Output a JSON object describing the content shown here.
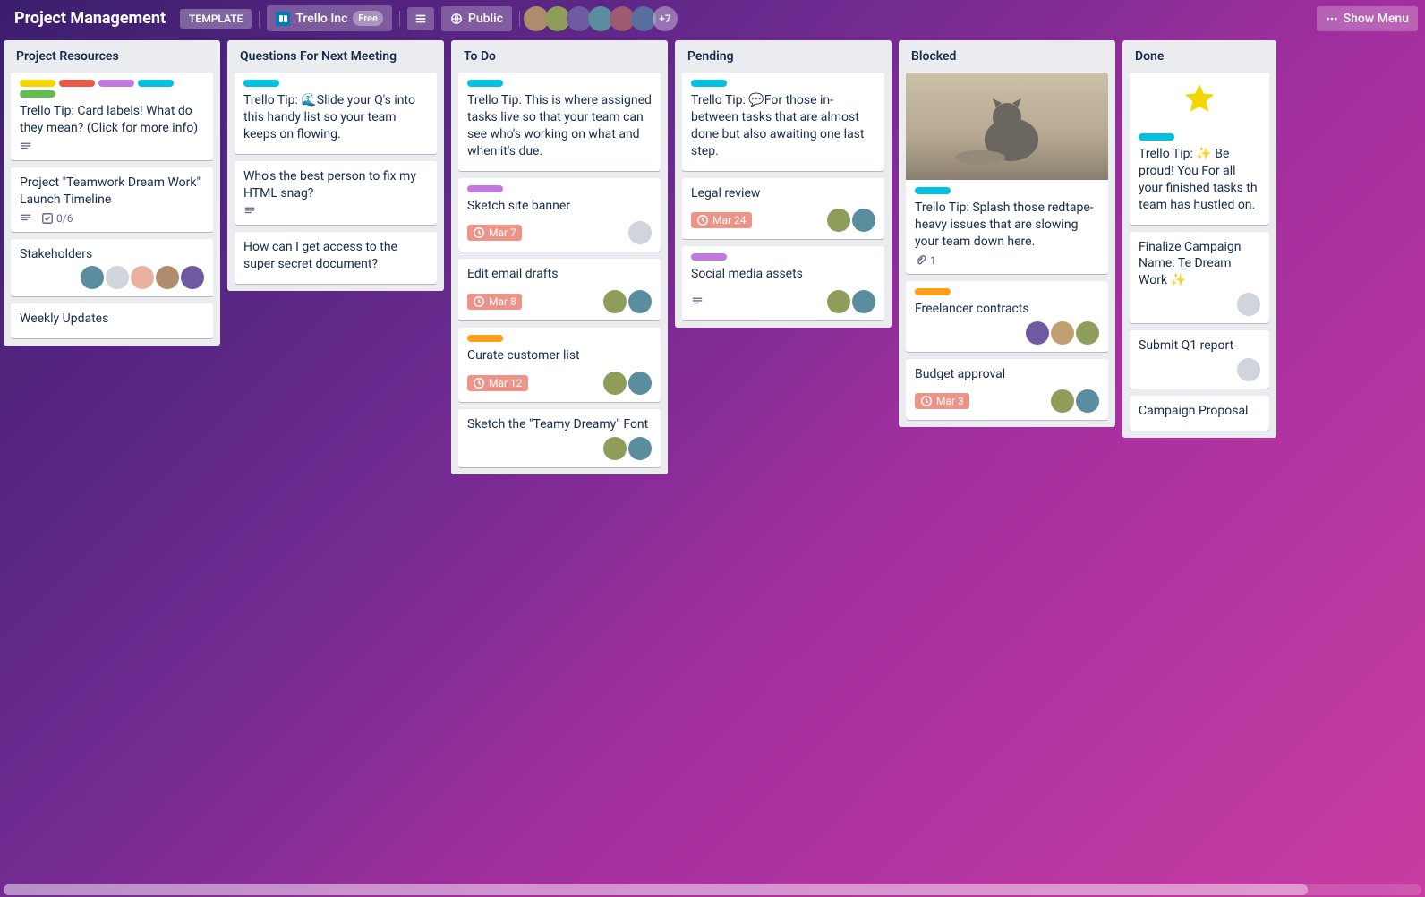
{
  "colors": {
    "yellow": "#f2d600",
    "red": "#eb5a46",
    "purple": "#c377e0",
    "sky": "#00c2e0",
    "green": "#61bd4f",
    "orange": "#ff9f1a"
  },
  "header": {
    "board_name": "Project Management",
    "template_badge": "TEMPLATE",
    "workspace": "Trello Inc",
    "workspace_pill": "Free",
    "visibility": "Public",
    "extra_members": "+7",
    "show_menu": "Show Menu"
  },
  "lists": [
    {
      "title": "Project Resources",
      "cards": [
        {
          "labels": [
            "yellow",
            "red",
            "purple",
            "sky",
            "green"
          ],
          "title": "Trello Tip: Card labels! What do they mean? (Click for more info)",
          "desc": true
        },
        {
          "title": "Project \"Teamwork Dream Work\" Launch Timeline",
          "desc": true,
          "checklist": "0/6"
        },
        {
          "title": "Stakeholders",
          "members": 5
        },
        {
          "title": "Weekly Updates"
        }
      ]
    },
    {
      "title": "Questions For Next Meeting",
      "cards": [
        {
          "labels": [
            "sky"
          ],
          "title": "Trello Tip: 🌊Slide your Q's into this handy list so your team keeps on flowing."
        },
        {
          "title": "Who's the best person to fix my HTML snag?",
          "desc": true
        },
        {
          "title": "How can I get access to the super secret document?"
        }
      ]
    },
    {
      "title": "To Do",
      "cards": [
        {
          "labels": [
            "sky"
          ],
          "title": "Trello Tip: This is where assigned tasks live so that your team can see who's working on what and when it's due."
        },
        {
          "labels": [
            "purple"
          ],
          "title": "Sketch site banner",
          "due": "Mar 7",
          "members": 1
        },
        {
          "title": "Edit email drafts",
          "due": "Mar 8",
          "members": 2
        },
        {
          "labels": [
            "orange"
          ],
          "title": "Curate customer list",
          "due": "Mar 12",
          "members": 2
        },
        {
          "title": "Sketch the \"Teamy Dreamy\" Font",
          "members": 2
        }
      ]
    },
    {
      "title": "Pending",
      "cards": [
        {
          "labels": [
            "sky"
          ],
          "title": "Trello Tip: 💬For those in-between tasks that are almost done but also awaiting one last step."
        },
        {
          "title": "Legal review",
          "due": "Mar 24",
          "members": 2
        },
        {
          "labels": [
            "purple"
          ],
          "title": "Social media assets",
          "desc": true,
          "members": 2
        }
      ]
    },
    {
      "title": "Blocked",
      "cards": [
        {
          "cover": "cat",
          "labels": [
            "sky"
          ],
          "title": "Trello Tip: Splash those redtape-heavy issues that are slowing your team down here.",
          "attach": "1"
        },
        {
          "labels": [
            "orange"
          ],
          "title": "Freelancer contracts",
          "members": 3
        },
        {
          "title": "Budget approval",
          "due": "Mar 3",
          "members": 2
        }
      ]
    },
    {
      "title": "Done",
      "cut": true,
      "cards": [
        {
          "cover": "star",
          "labels": [
            "sky"
          ],
          "title": "Trello Tip: ✨ Be proud! You For all your finished tasks th team has hustled on."
        },
        {
          "title": "Finalize Campaign Name: Te Dream Work ✨",
          "members": 1
        },
        {
          "title": "Submit Q1 report",
          "members": 1
        },
        {
          "title": "Campaign Proposal"
        }
      ]
    }
  ]
}
